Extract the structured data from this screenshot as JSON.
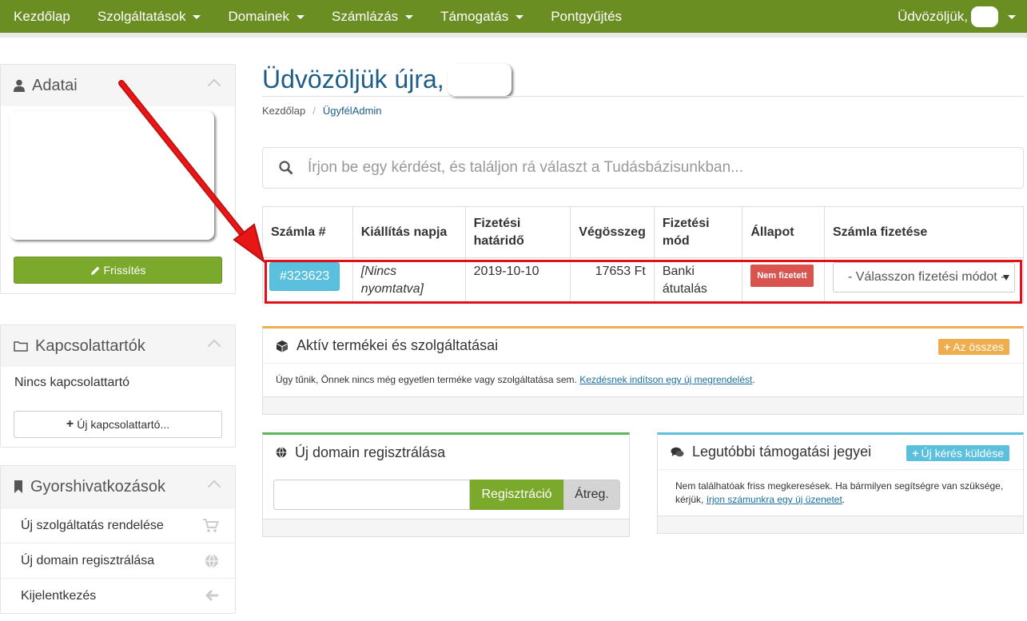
{
  "nav": {
    "items": [
      {
        "label": "Kezdőlap",
        "dropdown": false
      },
      {
        "label": "Szolgáltatások",
        "dropdown": true
      },
      {
        "label": "Domainek",
        "dropdown": true
      },
      {
        "label": "Számlázás",
        "dropdown": true
      },
      {
        "label": "Támogatás",
        "dropdown": true
      },
      {
        "label": "Pontgyűjtés",
        "dropdown": false
      }
    ],
    "welcome": "Üdvözöljük,"
  },
  "sidebar": {
    "details": {
      "title": "Adatai",
      "refresh_label": "Frissítés"
    },
    "contacts": {
      "title": "Kapcsolattartók",
      "empty_text": "Nincs kapcsolattartó",
      "new_label": "Új kapcsolattartó..."
    },
    "shortcuts": {
      "title": "Gyorshivatkozások",
      "items": [
        {
          "label": "Új szolgáltatás rendelése",
          "icon": "cart-icon"
        },
        {
          "label": "Új domain regisztrálása",
          "icon": "globe-icon"
        },
        {
          "label": "Kijelentkezés",
          "icon": "arrow-left-icon"
        }
      ]
    }
  },
  "main": {
    "title": "Üdvözöljük újra,",
    "breadcrumb": {
      "home": "Kezdőlap",
      "current": "ÜgyfélAdmin"
    },
    "search": {
      "placeholder": "Írjon be egy kérdést, és találjon rá választ a Tudásbázisunkban..."
    },
    "invoice_table": {
      "headers": [
        "Számla #",
        "Kiállítás napja",
        "Fizetési határidő",
        "Végösszeg",
        "Fizetési mód",
        "Állapot",
        "Számla fizetése"
      ],
      "rows": [
        {
          "number": "#323623",
          "issued": "[Nincs nyomtatva]",
          "due": "2019-10-10",
          "total": "17653 Ft",
          "method": "Banki átutalás",
          "status": "Nem fizetett",
          "payment_select": "- Válasszon fizetési módot -"
        }
      ]
    },
    "products": {
      "title": "Aktív termékei és szolgáltatásai",
      "all_label": "Az összes",
      "body_text": "Úgy tűnik, Önnek nincs még egyetlen terméke vagy szolgáltatása sem.",
      "link_text": "Kezdésnek indítson egy új megrendelést"
    },
    "domain": {
      "title": "Új domain regisztrálása",
      "register_label": "Regisztráció",
      "transfer_label": "Átreg."
    },
    "tickets": {
      "title": "Legutóbbi támogatási jegyei",
      "new_label": "Új kérés küldése",
      "body_text": "Nem találhatóak friss megkeresések. Ha bármilyen segítségre van szüksége, kérjük,",
      "link_text": "írjon számunkra egy új üzenetet"
    }
  },
  "colors": {
    "navbar": "#6b8e23",
    "green_button": "#7aa92b",
    "info_button": "#5bc0de",
    "status_unpaid": "#d9534f",
    "title_blue": "#1d5d87",
    "highlight_red": "#e3101a",
    "orange_accent": "#f0ad4e"
  }
}
